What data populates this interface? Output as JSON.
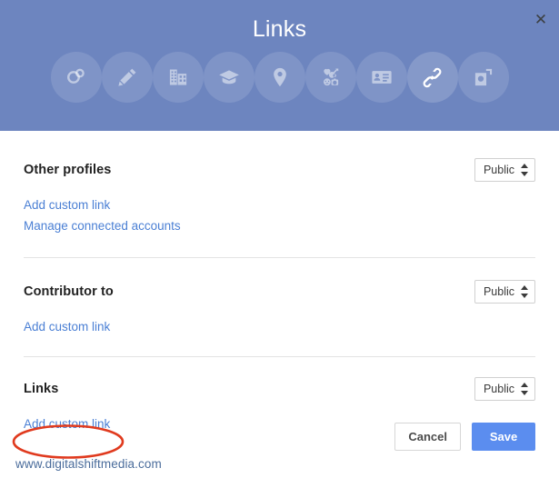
{
  "dialog": {
    "title": "Links",
    "close_label": "✕"
  },
  "header": {
    "icons": [
      {
        "name": "circles-icon",
        "label": "Circles"
      },
      {
        "name": "pencil-icon",
        "label": "Story"
      },
      {
        "name": "building-icon",
        "label": "Work"
      },
      {
        "name": "graduation-cap-icon",
        "label": "Education"
      },
      {
        "name": "location-pin-icon",
        "label": "Places"
      },
      {
        "name": "hobbies-grid-icon",
        "label": "Basic information"
      },
      {
        "name": "contact-card-icon",
        "label": "Contact information"
      },
      {
        "name": "chain-link-icon",
        "label": "Links",
        "active": true
      },
      {
        "name": "photos-icon",
        "label": "Photos"
      }
    ]
  },
  "sections": [
    {
      "title": "Other profiles",
      "visibility": "Public",
      "links": [
        "Add custom link",
        "Manage connected accounts"
      ]
    },
    {
      "title": "Contributor to",
      "visibility": "Public",
      "links": [
        "Add custom link"
      ]
    },
    {
      "title": "Links",
      "visibility": "Public",
      "links": [
        "Add custom link"
      ]
    }
  ],
  "footer": {
    "cancel_label": "Cancel",
    "save_label": "Save"
  },
  "watermark": "www.digitalshiftmedia.com",
  "annotation": {
    "shape": "ellipse",
    "color": "#e03a1e",
    "targets": "Add custom link"
  },
  "colors": {
    "header_bg": "#6d85bf",
    "link_blue": "#4a7fd4",
    "save_blue": "#5b8def",
    "annotation_red": "#e03a1e",
    "watermark_blue": "#4a6c9b"
  }
}
